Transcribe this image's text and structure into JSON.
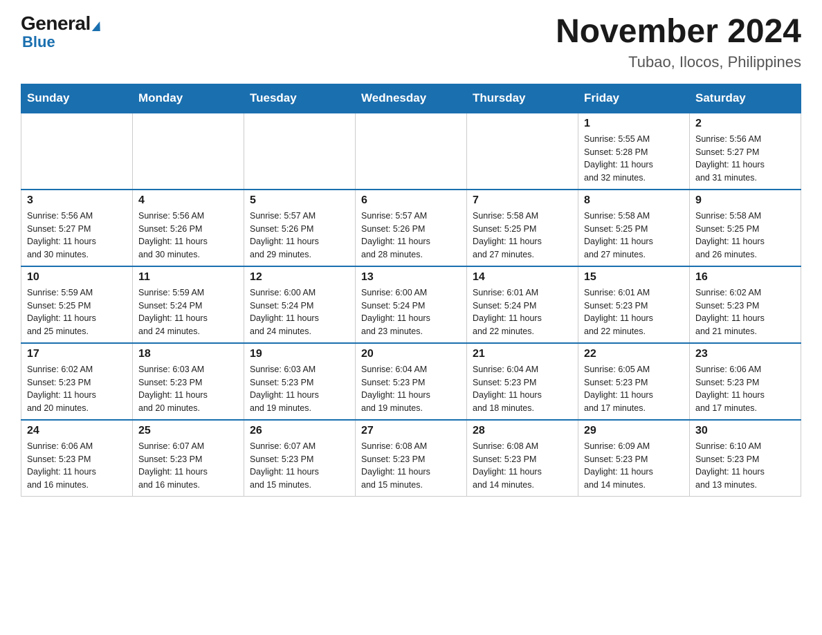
{
  "logo": {
    "general_label": "General",
    "blue_label": "Blue"
  },
  "header": {
    "month_year": "November 2024",
    "location": "Tubao, Ilocos, Philippines"
  },
  "days_of_week": [
    "Sunday",
    "Monday",
    "Tuesday",
    "Wednesday",
    "Thursday",
    "Friday",
    "Saturday"
  ],
  "weeks": [
    [
      {
        "day": "",
        "info": ""
      },
      {
        "day": "",
        "info": ""
      },
      {
        "day": "",
        "info": ""
      },
      {
        "day": "",
        "info": ""
      },
      {
        "day": "",
        "info": ""
      },
      {
        "day": "1",
        "info": "Sunrise: 5:55 AM\nSunset: 5:28 PM\nDaylight: 11 hours\nand 32 minutes."
      },
      {
        "day": "2",
        "info": "Sunrise: 5:56 AM\nSunset: 5:27 PM\nDaylight: 11 hours\nand 31 minutes."
      }
    ],
    [
      {
        "day": "3",
        "info": "Sunrise: 5:56 AM\nSunset: 5:27 PM\nDaylight: 11 hours\nand 30 minutes."
      },
      {
        "day": "4",
        "info": "Sunrise: 5:56 AM\nSunset: 5:26 PM\nDaylight: 11 hours\nand 30 minutes."
      },
      {
        "day": "5",
        "info": "Sunrise: 5:57 AM\nSunset: 5:26 PM\nDaylight: 11 hours\nand 29 minutes."
      },
      {
        "day": "6",
        "info": "Sunrise: 5:57 AM\nSunset: 5:26 PM\nDaylight: 11 hours\nand 28 minutes."
      },
      {
        "day": "7",
        "info": "Sunrise: 5:58 AM\nSunset: 5:25 PM\nDaylight: 11 hours\nand 27 minutes."
      },
      {
        "day": "8",
        "info": "Sunrise: 5:58 AM\nSunset: 5:25 PM\nDaylight: 11 hours\nand 27 minutes."
      },
      {
        "day": "9",
        "info": "Sunrise: 5:58 AM\nSunset: 5:25 PM\nDaylight: 11 hours\nand 26 minutes."
      }
    ],
    [
      {
        "day": "10",
        "info": "Sunrise: 5:59 AM\nSunset: 5:25 PM\nDaylight: 11 hours\nand 25 minutes."
      },
      {
        "day": "11",
        "info": "Sunrise: 5:59 AM\nSunset: 5:24 PM\nDaylight: 11 hours\nand 24 minutes."
      },
      {
        "day": "12",
        "info": "Sunrise: 6:00 AM\nSunset: 5:24 PM\nDaylight: 11 hours\nand 24 minutes."
      },
      {
        "day": "13",
        "info": "Sunrise: 6:00 AM\nSunset: 5:24 PM\nDaylight: 11 hours\nand 23 minutes."
      },
      {
        "day": "14",
        "info": "Sunrise: 6:01 AM\nSunset: 5:24 PM\nDaylight: 11 hours\nand 22 minutes."
      },
      {
        "day": "15",
        "info": "Sunrise: 6:01 AM\nSunset: 5:23 PM\nDaylight: 11 hours\nand 22 minutes."
      },
      {
        "day": "16",
        "info": "Sunrise: 6:02 AM\nSunset: 5:23 PM\nDaylight: 11 hours\nand 21 minutes."
      }
    ],
    [
      {
        "day": "17",
        "info": "Sunrise: 6:02 AM\nSunset: 5:23 PM\nDaylight: 11 hours\nand 20 minutes."
      },
      {
        "day": "18",
        "info": "Sunrise: 6:03 AM\nSunset: 5:23 PM\nDaylight: 11 hours\nand 20 minutes."
      },
      {
        "day": "19",
        "info": "Sunrise: 6:03 AM\nSunset: 5:23 PM\nDaylight: 11 hours\nand 19 minutes."
      },
      {
        "day": "20",
        "info": "Sunrise: 6:04 AM\nSunset: 5:23 PM\nDaylight: 11 hours\nand 19 minutes."
      },
      {
        "day": "21",
        "info": "Sunrise: 6:04 AM\nSunset: 5:23 PM\nDaylight: 11 hours\nand 18 minutes."
      },
      {
        "day": "22",
        "info": "Sunrise: 6:05 AM\nSunset: 5:23 PM\nDaylight: 11 hours\nand 17 minutes."
      },
      {
        "day": "23",
        "info": "Sunrise: 6:06 AM\nSunset: 5:23 PM\nDaylight: 11 hours\nand 17 minutes."
      }
    ],
    [
      {
        "day": "24",
        "info": "Sunrise: 6:06 AM\nSunset: 5:23 PM\nDaylight: 11 hours\nand 16 minutes."
      },
      {
        "day": "25",
        "info": "Sunrise: 6:07 AM\nSunset: 5:23 PM\nDaylight: 11 hours\nand 16 minutes."
      },
      {
        "day": "26",
        "info": "Sunrise: 6:07 AM\nSunset: 5:23 PM\nDaylight: 11 hours\nand 15 minutes."
      },
      {
        "day": "27",
        "info": "Sunrise: 6:08 AM\nSunset: 5:23 PM\nDaylight: 11 hours\nand 15 minutes."
      },
      {
        "day": "28",
        "info": "Sunrise: 6:08 AM\nSunset: 5:23 PM\nDaylight: 11 hours\nand 14 minutes."
      },
      {
        "day": "29",
        "info": "Sunrise: 6:09 AM\nSunset: 5:23 PM\nDaylight: 11 hours\nand 14 minutes."
      },
      {
        "day": "30",
        "info": "Sunrise: 6:10 AM\nSunset: 5:23 PM\nDaylight: 11 hours\nand 13 minutes."
      }
    ]
  ]
}
